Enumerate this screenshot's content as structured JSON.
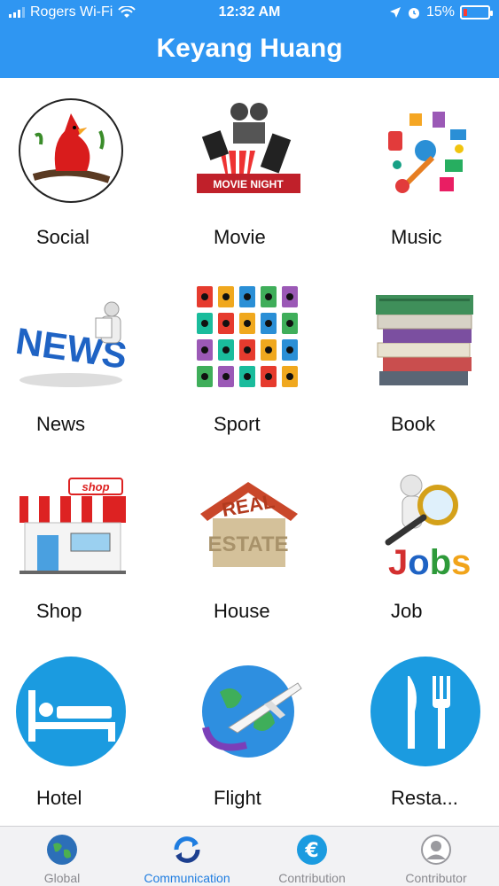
{
  "status": {
    "carrier": "Rogers Wi-Fi",
    "time": "12:32 AM",
    "battery_percent": "15%",
    "battery_level": 0.15
  },
  "header": {
    "title": "Keyang Huang"
  },
  "grid": {
    "items": [
      {
        "label": "Social",
        "icon": "cardinal-bird-icon"
      },
      {
        "label": "Movie",
        "icon": "movie-night-icon"
      },
      {
        "label": "Music",
        "icon": "music-collage-icon"
      },
      {
        "label": "News",
        "icon": "news-3d-icon"
      },
      {
        "label": "Sport",
        "icon": "sports-tiles-icon"
      },
      {
        "label": "Book",
        "icon": "book-stack-icon"
      },
      {
        "label": "Shop",
        "icon": "shop-front-icon"
      },
      {
        "label": "House",
        "icon": "real-estate-house-icon"
      },
      {
        "label": "Job",
        "icon": "jobs-magnifier-icon"
      },
      {
        "label": "Hotel",
        "icon": "hotel-bed-icon"
      },
      {
        "label": "Flight",
        "icon": "globe-plane-icon"
      },
      {
        "label": "Resta...",
        "icon": "fork-knife-icon"
      }
    ]
  },
  "tabbar": {
    "tabs": [
      {
        "label": "Global",
        "icon": "globe-icon",
        "active": false
      },
      {
        "label": "Communication",
        "icon": "sync-arrows-icon",
        "active": true
      },
      {
        "label": "Contribution",
        "icon": "euro-coin-icon",
        "active": false
      },
      {
        "label": "Contributor",
        "icon": "user-avatar-icon",
        "active": false
      }
    ]
  },
  "colors": {
    "nav_blue": "#2f96f2",
    "icon_blue": "#1b9be0",
    "active_tab": "#1f7de0"
  }
}
